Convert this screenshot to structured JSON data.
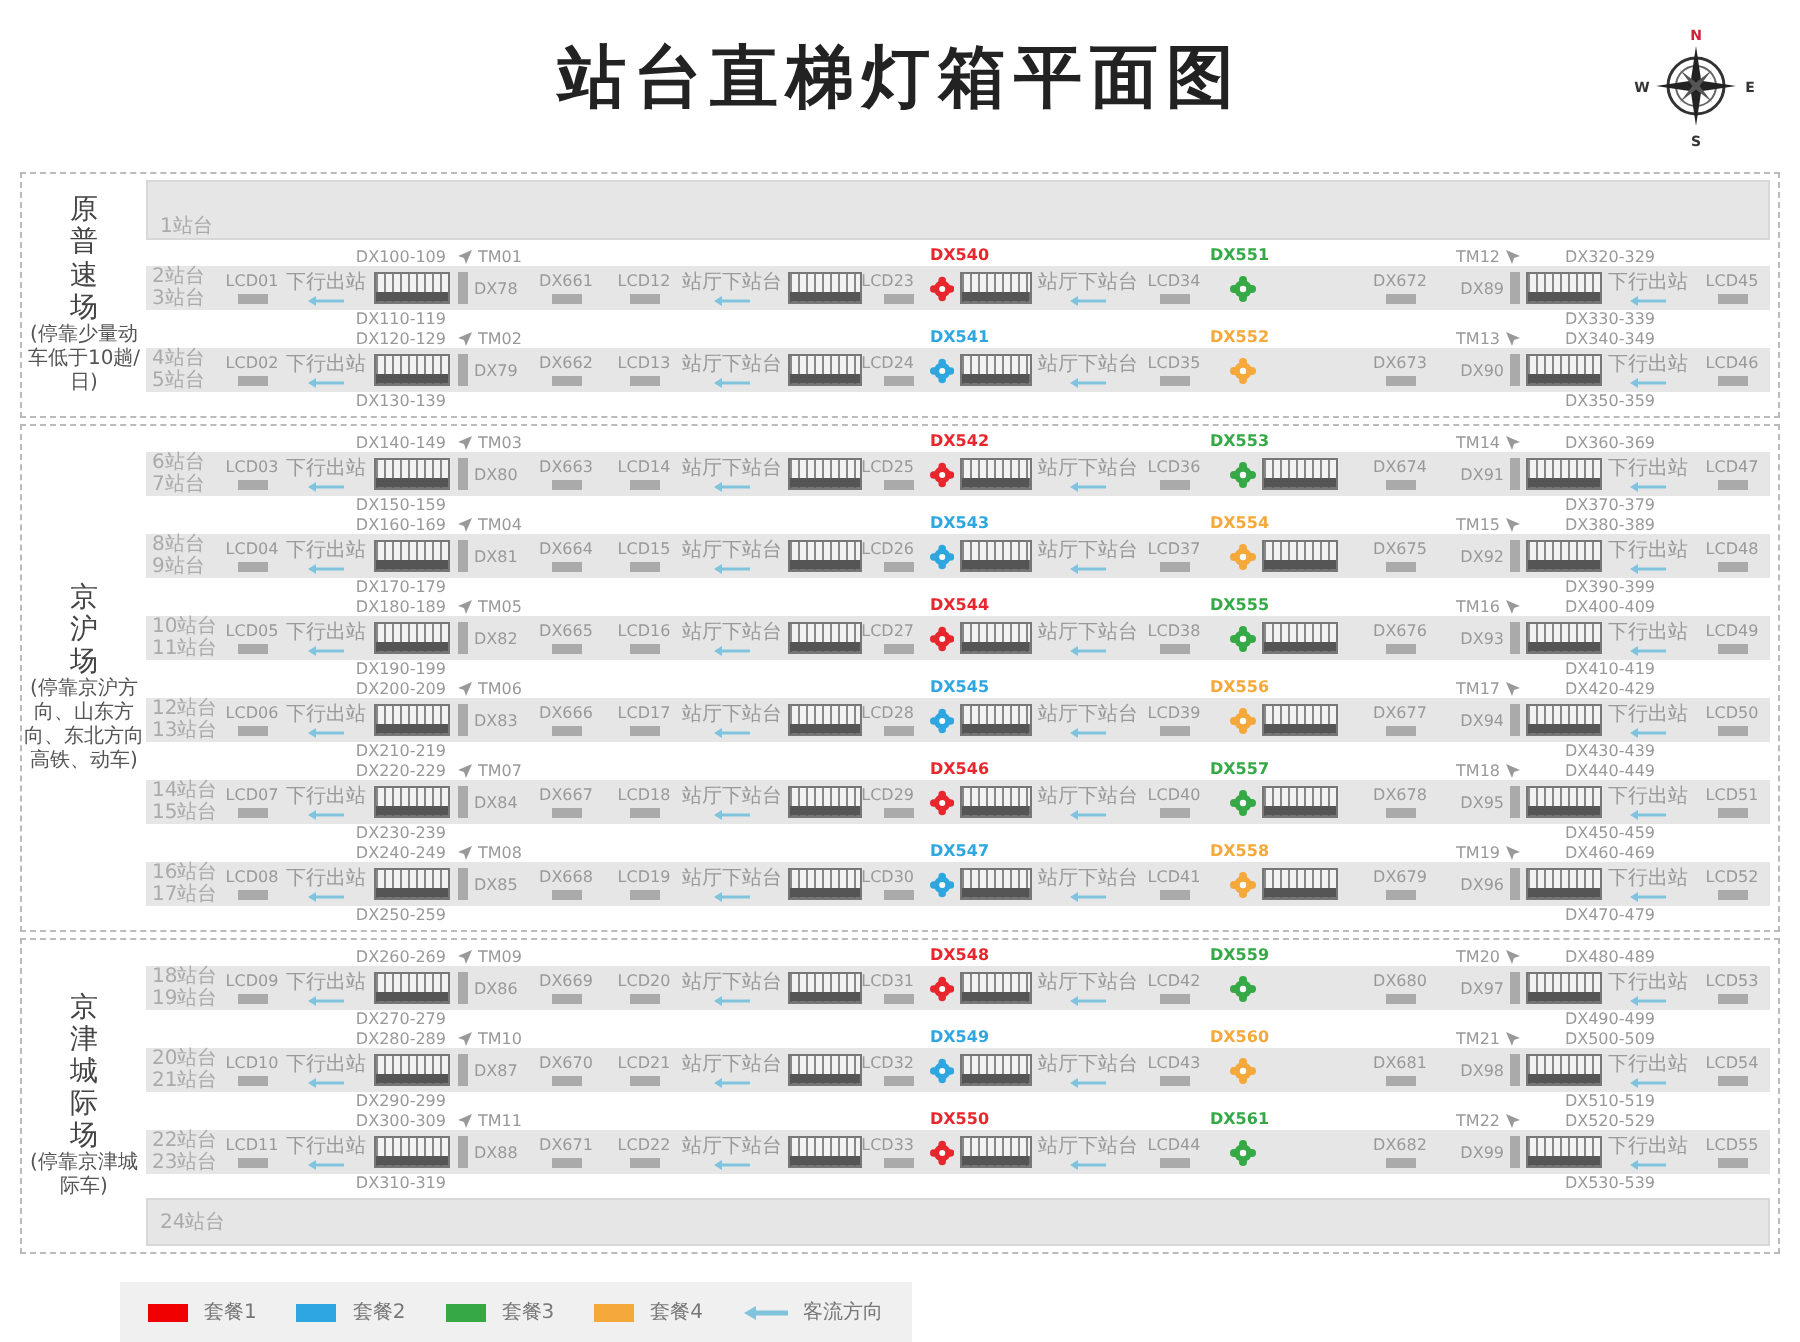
{
  "title": "站台直梯灯箱平面图",
  "compass": {
    "n": "N",
    "w": "W",
    "e": "E",
    "s": "S"
  },
  "sections": [
    {
      "name": "原普速场",
      "note": "(停靠少量动车低于10趟/日)",
      "top_platform": "1站台",
      "rows": [
        {
          "platforms": [
            "2站台",
            "3站台"
          ],
          "lcds": [
            "LCD01",
            "LCD12",
            "LCD23",
            "LCD34",
            "LCD45"
          ],
          "exits": [
            "下行出站",
            "下行出站"
          ],
          "stairs": [
            "站厅下站台",
            "站厅下站台"
          ],
          "left": {
            "range_top": "DX100-109",
            "range_bottom": "DX110-119",
            "tm": "TM01",
            "box": "DX78"
          },
          "signs": [
            "DX661",
            "DX672"
          ],
          "pkg_a": {
            "code": "DX540",
            "color": "#e8262d"
          },
          "pkg_b": {
            "code": "DX551",
            "color": "#36a947",
            "kind": "plain"
          },
          "right": {
            "tm": "TM12",
            "box": "DX89",
            "range_top": "DX320-329",
            "range_bottom": "DX330-339"
          }
        },
        {
          "platforms": [
            "4站台",
            "5站台"
          ],
          "lcds": [
            "LCD02",
            "LCD13",
            "LCD24",
            "LCD35",
            "LCD46"
          ],
          "exits": [
            "下行出站",
            "下行出站"
          ],
          "stairs": [
            "站厅下站台",
            "站厅下站台"
          ],
          "left": {
            "range_top": "DX120-129",
            "range_bottom": "DX130-139",
            "tm": "TM02",
            "box": "DX79"
          },
          "signs": [
            "DX662",
            "DX673"
          ],
          "pkg_a": {
            "code": "DX541",
            "color": "#2ea7e0"
          },
          "pkg_b": {
            "code": "DX552",
            "color": "#f4a93a",
            "kind": "plain"
          },
          "right": {
            "tm": "TM13",
            "box": "DX90",
            "range_top": "DX340-349",
            "range_bottom": "DX350-359"
          }
        }
      ]
    },
    {
      "name": "京沪场",
      "note": "(停靠京沪方向、山东方向、东北方向高铁、动车)",
      "rows": [
        {
          "platforms": [
            "6站台",
            "7站台"
          ],
          "lcds": [
            "LCD03",
            "LCD14",
            "LCD25",
            "LCD36",
            "LCD47"
          ],
          "exits": [
            "下行出站",
            "下行出站"
          ],
          "stairs": [
            "站厅下站台",
            "站厅下站台"
          ],
          "left": {
            "range_top": "DX140-149",
            "range_bottom": "DX150-159",
            "tm": "TM03",
            "box": "DX80"
          },
          "signs": [
            "DX663",
            "DX674"
          ],
          "pkg_a": {
            "code": "DX542",
            "color": "#e8262d"
          },
          "pkg_b": {
            "code": "DX553",
            "color": "#36a947",
            "kind": "escalator"
          },
          "right": {
            "tm": "TM14",
            "box": "DX91",
            "range_top": "DX360-369",
            "range_bottom": "DX370-379"
          }
        },
        {
          "platforms": [
            "8站台",
            "9站台"
          ],
          "lcds": [
            "LCD04",
            "LCD15",
            "LCD26",
            "LCD37",
            "LCD48"
          ],
          "exits": [
            "下行出站",
            "下行出站"
          ],
          "stairs": [
            "站厅下站台",
            "站厅下站台"
          ],
          "left": {
            "range_top": "DX160-169",
            "range_bottom": "DX170-179",
            "tm": "TM04",
            "box": "DX81"
          },
          "signs": [
            "DX664",
            "DX675"
          ],
          "pkg_a": {
            "code": "DX543",
            "color": "#2ea7e0"
          },
          "pkg_b": {
            "code": "DX554",
            "color": "#f4a93a",
            "kind": "escalator"
          },
          "right": {
            "tm": "TM15",
            "box": "DX92",
            "range_top": "DX380-389",
            "range_bottom": "DX390-399"
          }
        },
        {
          "platforms": [
            "10站台",
            "11站台"
          ],
          "lcds": [
            "LCD05",
            "LCD16",
            "LCD27",
            "LCD38",
            "LCD49"
          ],
          "exits": [
            "下行出站",
            "下行出站"
          ],
          "stairs": [
            "站厅下站台",
            "站厅下站台"
          ],
          "left": {
            "range_top": "DX180-189",
            "range_bottom": "DX190-199",
            "tm": "TM05",
            "box": "DX82"
          },
          "signs": [
            "DX665",
            "DX676"
          ],
          "pkg_a": {
            "code": "DX544",
            "color": "#e8262d"
          },
          "pkg_b": {
            "code": "DX555",
            "color": "#36a947",
            "kind": "escalator"
          },
          "right": {
            "tm": "TM16",
            "box": "DX93",
            "range_top": "DX400-409",
            "range_bottom": "DX410-419"
          }
        },
        {
          "platforms": [
            "12站台",
            "13站台"
          ],
          "lcds": [
            "LCD06",
            "LCD17",
            "LCD28",
            "LCD39",
            "LCD50"
          ],
          "exits": [
            "下行出站",
            "下行出站"
          ],
          "stairs": [
            "站厅下站台",
            "站厅下站台"
          ],
          "left": {
            "range_top": "DX200-209",
            "range_bottom": "DX210-219",
            "tm": "TM06",
            "box": "DX83"
          },
          "signs": [
            "DX666",
            "DX677"
          ],
          "pkg_a": {
            "code": "DX545",
            "color": "#2ea7e0"
          },
          "pkg_b": {
            "code": "DX556",
            "color": "#f4a93a",
            "kind": "escalator"
          },
          "right": {
            "tm": "TM17",
            "box": "DX94",
            "range_top": "DX420-429",
            "range_bottom": "DX430-439"
          }
        },
        {
          "platforms": [
            "14站台",
            "15站台"
          ],
          "lcds": [
            "LCD07",
            "LCD18",
            "LCD29",
            "LCD40",
            "LCD51"
          ],
          "exits": [
            "下行出站",
            "下行出站"
          ],
          "stairs": [
            "站厅下站台",
            "站厅下站台"
          ],
          "left": {
            "range_top": "DX220-229",
            "range_bottom": "DX230-239",
            "tm": "TM07",
            "box": "DX84"
          },
          "signs": [
            "DX667",
            "DX678"
          ],
          "pkg_a": {
            "code": "DX546",
            "color": "#e8262d"
          },
          "pkg_b": {
            "code": "DX557",
            "color": "#36a947",
            "kind": "escalator"
          },
          "right": {
            "tm": "TM18",
            "box": "DX95",
            "range_top": "DX440-449",
            "range_bottom": "DX450-459"
          }
        },
        {
          "platforms": [
            "16站台",
            "17站台"
          ],
          "lcds": [
            "LCD08",
            "LCD19",
            "LCD30",
            "LCD41",
            "LCD52"
          ],
          "exits": [
            "下行出站",
            "下行出站"
          ],
          "stairs": [
            "站厅下站台",
            "站厅下站台"
          ],
          "left": {
            "range_top": "DX240-249",
            "range_bottom": "DX250-259",
            "tm": "TM08",
            "box": "DX85"
          },
          "signs": [
            "DX668",
            "DX679"
          ],
          "pkg_a": {
            "code": "DX547",
            "color": "#2ea7e0"
          },
          "pkg_b": {
            "code": "DX558",
            "color": "#f4a93a",
            "kind": "escalator"
          },
          "right": {
            "tm": "TM19",
            "box": "DX96",
            "range_top": "DX460-469",
            "range_bottom": "DX470-479"
          }
        }
      ]
    },
    {
      "name": "京津城际场",
      "note": "(停靠京津城际车)",
      "bottom_platform": "24站台",
      "rows": [
        {
          "platforms": [
            "18站台",
            "19站台"
          ],
          "lcds": [
            "LCD09",
            "LCD20",
            "LCD31",
            "LCD42",
            "LCD53"
          ],
          "exits": [
            "下行出站",
            "下行出站"
          ],
          "stairs": [
            "站厅下站台",
            "站厅下站台"
          ],
          "left": {
            "range_top": "DX260-269",
            "range_bottom": "DX270-279",
            "tm": "TM09",
            "box": "DX86"
          },
          "signs": [
            "DX669",
            "DX680"
          ],
          "pkg_a": {
            "code": "DX548",
            "color": "#e8262d"
          },
          "pkg_b": {
            "code": "DX559",
            "color": "#36a947",
            "kind": "plain"
          },
          "right": {
            "tm": "TM20",
            "box": "DX97",
            "range_top": "DX480-489",
            "range_bottom": "DX490-499"
          }
        },
        {
          "platforms": [
            "20站台",
            "21站台"
          ],
          "lcds": [
            "LCD10",
            "LCD21",
            "LCD32",
            "LCD43",
            "LCD54"
          ],
          "exits": [
            "下行出站",
            "下行出站"
          ],
          "stairs": [
            "站厅下站台",
            "站厅下站台"
          ],
          "left": {
            "range_top": "DX280-289",
            "range_bottom": "DX290-299",
            "tm": "TM10",
            "box": "DX87"
          },
          "signs": [
            "DX670",
            "DX681"
          ],
          "pkg_a": {
            "code": "DX549",
            "color": "#2ea7e0"
          },
          "pkg_b": {
            "code": "DX560",
            "color": "#f4a93a",
            "kind": "plain"
          },
          "right": {
            "tm": "TM21",
            "box": "DX98",
            "range_top": "DX500-509",
            "range_bottom": "DX510-519"
          }
        },
        {
          "platforms": [
            "22站台",
            "23站台"
          ],
          "lcds": [
            "LCD11",
            "LCD22",
            "LCD33",
            "LCD44",
            "LCD55"
          ],
          "exits": [
            "下行出站",
            "下行出站"
          ],
          "stairs": [
            "站厅下站台",
            "站厅下站台"
          ],
          "left": {
            "range_top": "DX300-309",
            "range_bottom": "DX310-319",
            "tm": "TM11",
            "box": "DX88"
          },
          "signs": [
            "DX671",
            "DX682"
          ],
          "pkg_a": {
            "code": "DX550",
            "color": "#e8262d"
          },
          "pkg_b": {
            "code": "DX561",
            "color": "#36a947",
            "kind": "plain"
          },
          "right": {
            "tm": "TM22",
            "box": "DX99",
            "range_top": "DX520-529",
            "range_bottom": "DX530-539"
          }
        }
      ]
    }
  ],
  "legend": {
    "items": [
      {
        "label": "套餐1",
        "color": "#f00000"
      },
      {
        "label": "套餐2",
        "color": "#2ea7e0"
      },
      {
        "label": "套餐3",
        "color": "#36a947"
      },
      {
        "label": "套餐4",
        "color": "#f4a93a"
      }
    ],
    "flow": "客流方向"
  }
}
